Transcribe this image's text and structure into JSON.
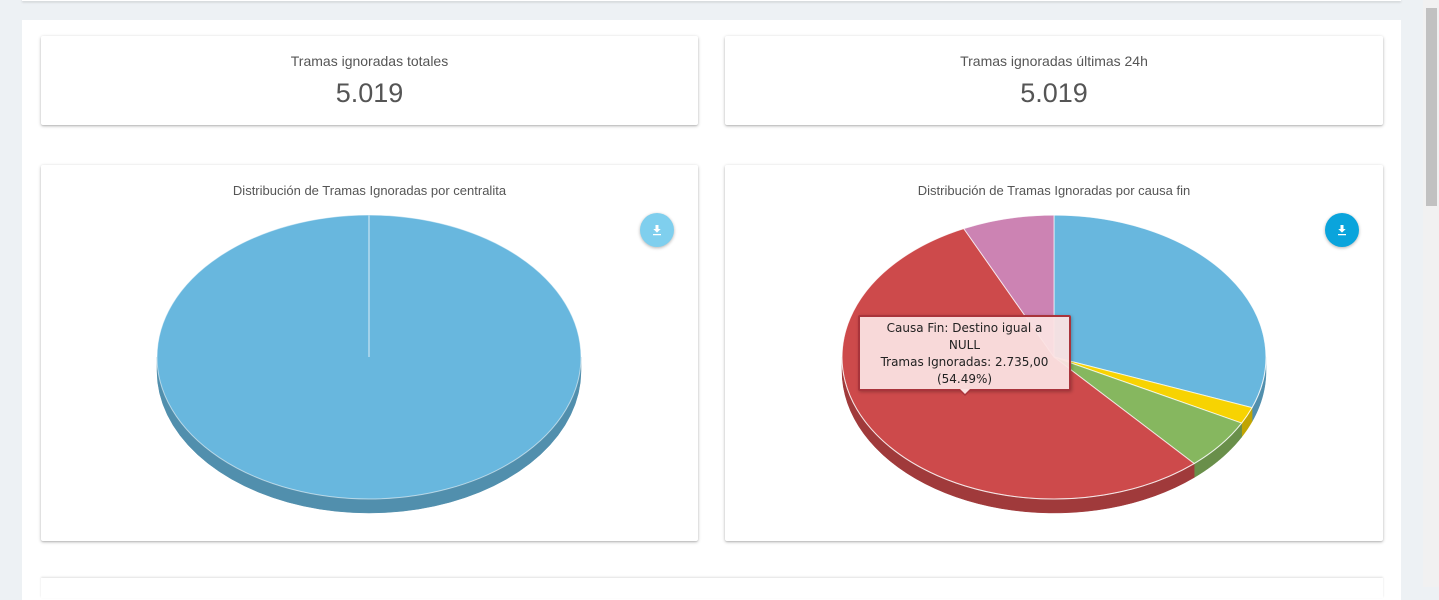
{
  "kpis": [
    {
      "label": "Tramas ignoradas totales",
      "value": "5.019"
    },
    {
      "label": "Tramas ignoradas últimas 24h",
      "value": "5.019"
    }
  ],
  "colors": {
    "blue": "#68b7de",
    "red": "#cd4a4b",
    "green": "#86b75f",
    "yellow": "#f7d302",
    "pink": "#cc83b3",
    "download_active": "#0aa4dc",
    "download_faded": "#7fcfee"
  },
  "icons": {
    "download": "download-icon"
  },
  "chart_data": [
    {
      "type": "pie",
      "title": "Distribución de Tramas Ignoradas por centralita",
      "slices": [
        {
          "label": "",
          "value": 100,
          "color": "#68b7de"
        }
      ]
    },
    {
      "type": "pie",
      "title": "Distribución de Tramas Ignoradas por causa fin",
      "slices": [
        {
          "label": "",
          "value": 30.8,
          "color": "#68b7de"
        },
        {
          "label": "",
          "value": 1.9,
          "color": "#f7d302"
        },
        {
          "label": "",
          "value": 5.8,
          "color": "#86b75f"
        },
        {
          "label": "Destino igual a NULL",
          "value": 54.49,
          "color": "#cd4a4b"
        },
        {
          "label": "",
          "value": 7.0,
          "color": "#cc83b3"
        }
      ],
      "tooltip": {
        "line1": "Causa Fin: Destino igual a",
        "line2": "NULL",
        "line3": "Tramas Ignoradas: 2.735,00",
        "line4": "(54.49%)"
      }
    }
  ]
}
